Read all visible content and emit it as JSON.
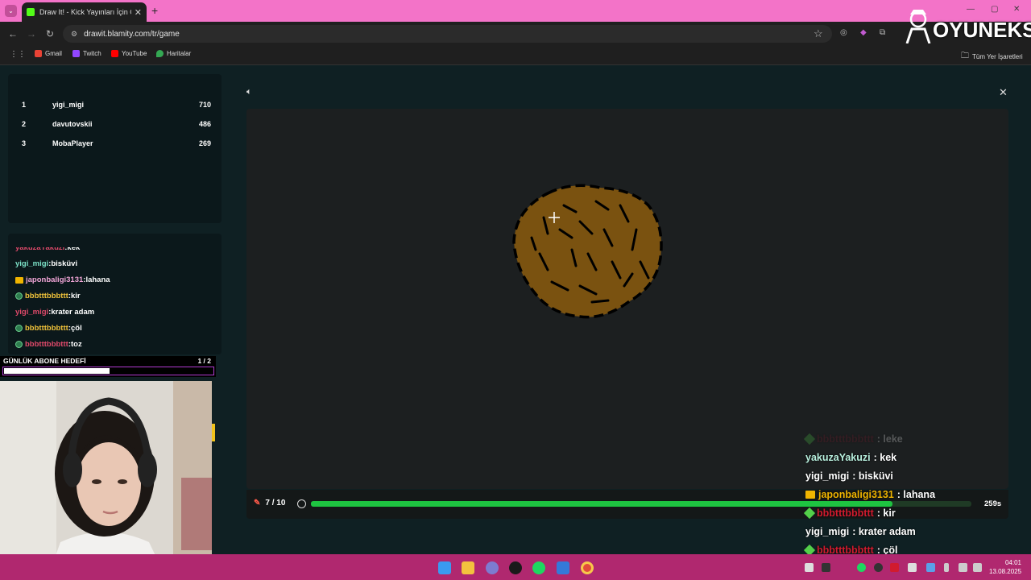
{
  "browser": {
    "tab_title": "Draw It! - Kick Yayınları İçin Çiz",
    "url": "drawit.blamity.com/tr/game",
    "bookmarks": [
      "Gmail",
      "Twitch",
      "YouTube",
      "Haritalar"
    ],
    "all_bookmarks": "Tüm Yer İşaretleri"
  },
  "leaderboard": [
    {
      "rank": "1",
      "name": "yigi_migi",
      "score": "710"
    },
    {
      "rank": "2",
      "name": "davutovskii",
      "score": "486"
    },
    {
      "rank": "3",
      "name": "MobaPlayer",
      "score": "269"
    }
  ],
  "side_chat": [
    {
      "user": "yakuzaYakuzi",
      "msg": ":kek",
      "color": "#e14a6b",
      "badge": "none"
    },
    {
      "user": "yigi_migi",
      "msg": ":bisküvi",
      "color": "#7de3c9",
      "badge": "none"
    },
    {
      "user": "japonbaligi3131",
      "msg": ":lahana",
      "color": "#f3a6d8",
      "badge": "crown"
    },
    {
      "user": "bbbtttbbbttt",
      "msg": ":kir",
      "color": "#f0c23a",
      "badge": "circle"
    },
    {
      "user": "yigi_migi",
      "msg": ":krater adam",
      "color": "#e14a6b",
      "badge": "none"
    },
    {
      "user": "bbbtttbbbttt",
      "msg": ":çöl",
      "color": "#f0c23a",
      "badge": "circle"
    },
    {
      "user": "bbbtttbbbttt",
      "msg": ":toz",
      "color": "#e14a6b",
      "badge": "circle"
    }
  ],
  "sub_goal": {
    "label": "GÜNLÜK ABONE HEDEFİ",
    "count": "1 / 2",
    "progress": 0.5
  },
  "game": {
    "round": "7 / 10",
    "time_left": "259s",
    "time_progress": 0.88
  },
  "overlay_chat": [
    {
      "user": "bbbtttbbbttt",
      "msg": ": leke",
      "color": "#7a1a2a",
      "badge": "diamond",
      "faded": true
    },
    {
      "user": "yakuzaYakuzi",
      "msg": ": kek",
      "color": "#b8f0de",
      "badge": "none",
      "faded": false
    },
    {
      "user": "yigi_migi",
      "msg": ": bisküvi",
      "color": "#ffffff",
      "badge": "none",
      "faded": false
    },
    {
      "user": "japonbaligi3131",
      "msg": ": lahana",
      "color": "#f0b400",
      "badge": "crown",
      "faded": false
    },
    {
      "user": "bbbtttbbbttt",
      "msg": ": kir",
      "color": "#d11b2e",
      "badge": "diamond",
      "faded": false
    },
    {
      "user": "yigi_migi",
      "msg": ": krater adam",
      "color": "#ffffff",
      "badge": "none",
      "faded": false
    },
    {
      "user": "bbbtttbbbttt",
      "msg": ": çöl",
      "color": "#d11b2e",
      "badge": "diamond",
      "faded": false
    }
  ],
  "logo_text": "OYUNEKS",
  "clock": {
    "time": "04:01",
    "date": "13.08.2025"
  }
}
